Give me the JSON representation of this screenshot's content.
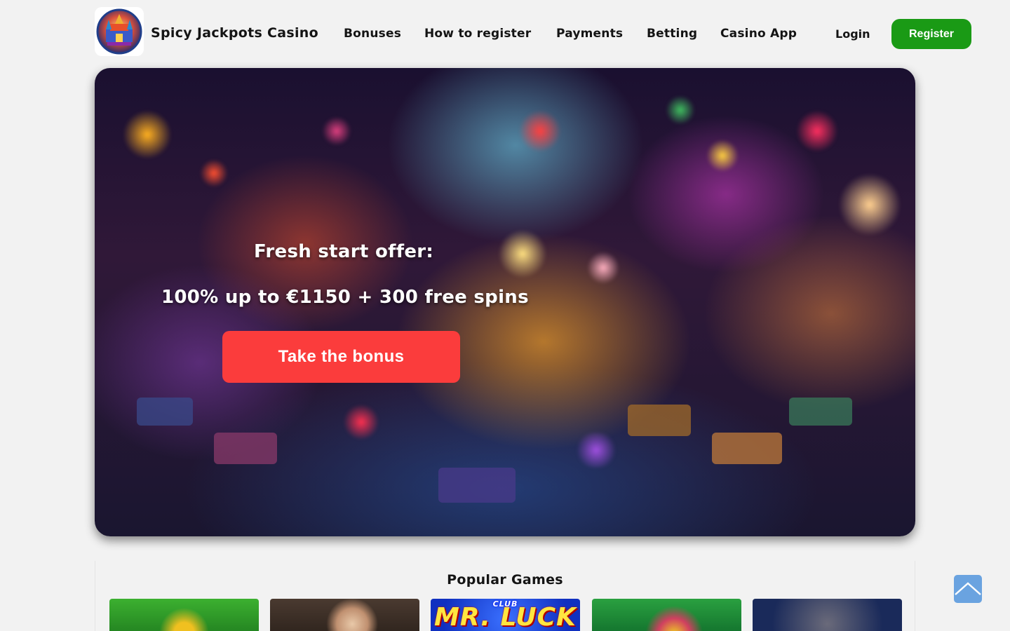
{
  "header": {
    "brand": "Spicy Jackpots Casino",
    "nav": [
      "Bonuses",
      "How to register",
      "Payments",
      "Betting",
      "Casino App"
    ],
    "login": "Login",
    "register": "Register"
  },
  "hero": {
    "title": "Fresh start offer:",
    "subtitle": "100% up to €1150 + 300 free spins",
    "cta": "Take the bonus"
  },
  "games": {
    "title": "Popular Games",
    "items": [
      {
        "name": "game-1",
        "label": ""
      },
      {
        "name": "game-2",
        "label": ""
      },
      {
        "name": "game-3",
        "label": "MR. LUCK",
        "sublabel": "CLUB"
      },
      {
        "name": "game-4",
        "label": ""
      },
      {
        "name": "game-5",
        "label": ""
      }
    ]
  },
  "colors": {
    "register_bg": "#1a9a15",
    "cta_bg": "#fb3c3c",
    "page_bg": "#f2f2f2",
    "to_top_bg": "#6aa3e0"
  },
  "icons": {
    "logo": "casino-palace-logo",
    "to_top": "chevron-up-icon"
  }
}
